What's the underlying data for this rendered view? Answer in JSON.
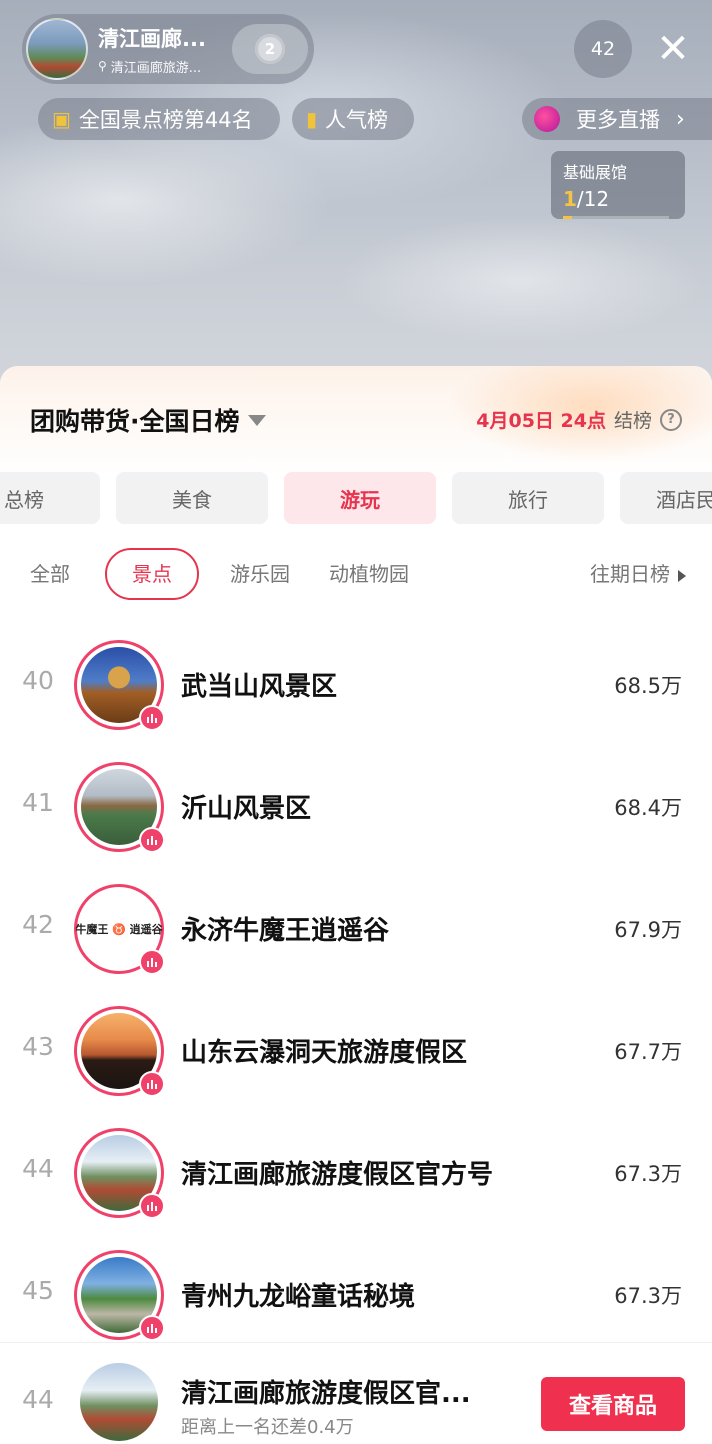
{
  "header": {
    "host_name": "清江画廊...",
    "host_location": "清江画廊旅游...",
    "heart_level": "2",
    "viewer_count": "42",
    "close_symbol": "✕"
  },
  "chips": {
    "rank_label": "全国景点榜第44名",
    "popularity_label": "人气榜",
    "more_live_label": "更多直播",
    "more_live_arrow": "›"
  },
  "pavilion": {
    "label": "基础展馆",
    "current": "1",
    "total": "/12",
    "progress_fraction": 0.083
  },
  "board": {
    "title": "团购带货·全国日榜",
    "settle_datetime": "4月05日 24点",
    "settle_text": "结榜",
    "help_symbol": "?"
  },
  "tabs": [
    "总榜",
    "美食",
    "游玩",
    "旅行",
    "酒店民宿"
  ],
  "active_tab_index": 2,
  "subtabs": [
    "全部",
    "景点",
    "游乐园",
    "动植物园"
  ],
  "active_subtab_index": 1,
  "past_label": "往期日榜",
  "ranking": [
    {
      "rank": "40",
      "name": "武当山风景区",
      "score": "68.5万"
    },
    {
      "rank": "41",
      "name": "沂山风景区",
      "score": "68.4万"
    },
    {
      "rank": "42",
      "name": "永济牛魔王逍遥谷",
      "score": "67.9万"
    },
    {
      "rank": "43",
      "name": "山东云瀑洞天旅游度假区",
      "score": "67.7万"
    },
    {
      "rank": "44",
      "name": "清江画廊旅游度假区官方号",
      "score": "67.3万"
    },
    {
      "rank": "45",
      "name": "青州九龙峪童话秘境",
      "score": "67.3万"
    }
  ],
  "logo_text": {
    "left": "牛魔王",
    "right": "逍遥谷"
  },
  "my_rank": {
    "rank": "44",
    "name": "清江画廊旅游度假区官...",
    "gap_text": "距离上一名还差0.4万",
    "button_label": "查看商品"
  },
  "colors": {
    "accent": "#e6344f",
    "live_ring": "#f0416a",
    "gold": "#f6c445"
  }
}
